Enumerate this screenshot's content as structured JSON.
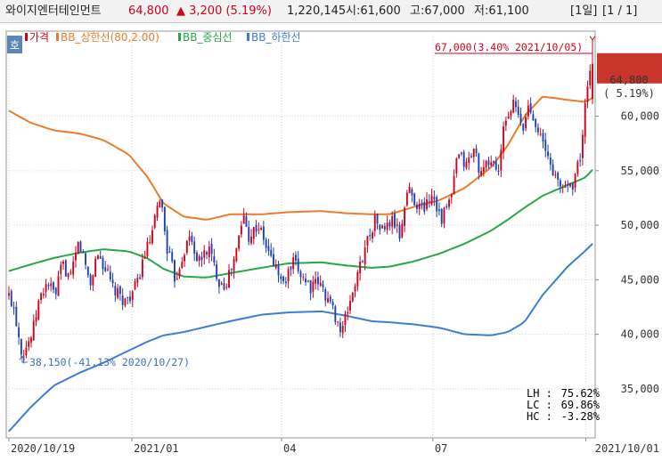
{
  "header": {
    "name": "와이지엔터테인먼트",
    "price": "64,800",
    "change": "▲ 3,200 (5.19%)",
    "volume": "1,220,145",
    "open": "시:61,600",
    "high": "고:67,000",
    "low": "저:61,100",
    "period": "[1일]",
    "page": "[1 / 1]"
  },
  "side_tab_label": "호",
  "colors": {
    "up": "#d0021b",
    "down": "#1f3fb4",
    "bb_upper": "#f07a2a",
    "bb_mid": "#28a745",
    "bb_lower": "#3c7ed4"
  },
  "chart_data": {
    "type": "line",
    "title": "",
    "legend": [
      {
        "key": "price",
        "label": "가격",
        "color": "#d0021b"
      },
      {
        "key": "upper",
        "label": "BB_상한선(80,2.00)",
        "color": "#f07a2a"
      },
      {
        "key": "mid",
        "label": "BB_중심선",
        "color": "#28a745"
      },
      {
        "key": "lower",
        "label": "BB_하한선",
        "color": "#3c7ed4"
      }
    ],
    "legend_position": "top-left",
    "x_ticks": [
      "2020/10/19",
      "2021/01",
      "04",
      "07",
      "2021/10/01"
    ],
    "x_tick_dates": [
      "2020-10-19",
      "2021-01-01",
      "2021-04-01",
      "2021-07-01",
      "2021-10-01"
    ],
    "y_ticks": [
      "35,000",
      "40,000",
      "45,000",
      "50,000",
      "55,000",
      "60,000"
    ],
    "ylim": [
      30500,
      67800
    ],
    "grid": true,
    "price_points": [
      [
        "2020-10-19",
        43500
      ],
      [
        "2020-10-22",
        42500
      ],
      [
        "2020-10-27",
        38150
      ],
      [
        "2020-11-02",
        40000
      ],
      [
        "2020-11-06",
        43000
      ],
      [
        "2020-11-11",
        44800
      ],
      [
        "2020-11-16",
        43500
      ],
      [
        "2020-11-20",
        46500
      ],
      [
        "2020-11-25",
        45000
      ],
      [
        "2020-11-30",
        48500
      ],
      [
        "2020-12-03",
        47000
      ],
      [
        "2020-12-07",
        44500
      ],
      [
        "2020-12-11",
        47500
      ],
      [
        "2020-12-16",
        46000
      ],
      [
        "2020-12-21",
        44000
      ],
      [
        "2020-12-28",
        43000
      ],
      [
        "2021-01-04",
        44500
      ],
      [
        "2021-01-08",
        47000
      ],
      [
        "2021-01-13",
        49000
      ],
      [
        "2021-01-18",
        52800
      ],
      [
        "2021-01-22",
        48000
      ],
      [
        "2021-01-27",
        45000
      ],
      [
        "2021-02-01",
        47500
      ],
      [
        "2021-02-05",
        49000
      ],
      [
        "2021-02-10",
        46500
      ],
      [
        "2021-02-16",
        48000
      ],
      [
        "2021-02-22",
        45000
      ],
      [
        "2021-02-26",
        44500
      ],
      [
        "2021-03-04",
        47000
      ],
      [
        "2021-03-09",
        51000
      ],
      [
        "2021-03-12",
        49000
      ],
      [
        "2021-03-18",
        50000
      ],
      [
        "2021-03-24",
        47500
      ],
      [
        "2021-03-29",
        46000
      ],
      [
        "2021-04-02",
        44500
      ],
      [
        "2021-04-08",
        46500
      ],
      [
        "2021-04-13",
        45500
      ],
      [
        "2021-04-19",
        44200
      ],
      [
        "2021-04-23",
        44800
      ],
      [
        "2021-04-29",
        43200
      ],
      [
        "2021-05-04",
        41500
      ],
      [
        "2021-05-07",
        40000
      ],
      [
        "2021-05-12",
        43000
      ],
      [
        "2021-05-17",
        45500
      ],
      [
        "2021-05-21",
        48000
      ],
      [
        "2021-05-27",
        50500
      ],
      [
        "2021-06-01",
        49500
      ],
      [
        "2021-06-07",
        50500
      ],
      [
        "2021-06-11",
        49000
      ],
      [
        "2021-06-16",
        53500
      ],
      [
        "2021-06-21",
        52000
      ],
      [
        "2021-06-25",
        51500
      ],
      [
        "2021-07-01",
        53000
      ],
      [
        "2021-07-06",
        50500
      ],
      [
        "2021-07-12",
        52500
      ],
      [
        "2021-07-16",
        56500
      ],
      [
        "2021-07-21",
        55500
      ],
      [
        "2021-07-26",
        57000
      ],
      [
        "2021-07-30",
        54500
      ],
      [
        "2021-08-04",
        56000
      ],
      [
        "2021-08-10",
        55000
      ],
      [
        "2021-08-13",
        59500
      ],
      [
        "2021-08-19",
        61200
      ],
      [
        "2021-08-24",
        58500
      ],
      [
        "2021-08-27",
        61000
      ],
      [
        "2021-09-01",
        59500
      ],
      [
        "2021-09-06",
        57000
      ],
      [
        "2021-09-10",
        55500
      ],
      [
        "2021-09-15",
        53500
      ],
      [
        "2021-09-23",
        53800
      ],
      [
        "2021-09-28",
        56500
      ],
      [
        "2021-10-01",
        61600
      ],
      [
        "2021-10-05",
        64800
      ]
    ],
    "series": [
      {
        "key": "upper",
        "name": "BB_상한선(80,2.00)",
        "points": [
          [
            "2020-10-19",
            60500
          ],
          [
            "2020-11-01",
            59400
          ],
          [
            "2020-11-15",
            58700
          ],
          [
            "2020-12-01",
            58400
          ],
          [
            "2020-12-15",
            57800
          ],
          [
            "2020-12-30",
            56500
          ],
          [
            "2021-01-10",
            54500
          ],
          [
            "2021-01-20",
            52000
          ],
          [
            "2021-02-01",
            50800
          ],
          [
            "2021-02-15",
            50500
          ],
          [
            "2021-03-01",
            51000
          ],
          [
            "2021-03-20",
            51000
          ],
          [
            "2021-04-05",
            51200
          ],
          [
            "2021-04-25",
            51300
          ],
          [
            "2021-05-10",
            51100
          ],
          [
            "2021-05-25",
            51000
          ],
          [
            "2021-06-05",
            51000
          ],
          [
            "2021-06-20",
            51700
          ],
          [
            "2021-07-05",
            52300
          ],
          [
            "2021-07-20",
            53400
          ],
          [
            "2021-08-05",
            55300
          ],
          [
            "2021-08-15",
            57300
          ],
          [
            "2021-08-25",
            60000
          ],
          [
            "2021-09-05",
            61800
          ],
          [
            "2021-09-20",
            61500
          ],
          [
            "2021-10-01",
            61300
          ],
          [
            "2021-10-05",
            61700
          ]
        ]
      },
      {
        "key": "mid",
        "name": "BB_중심선",
        "points": [
          [
            "2020-10-19",
            45800
          ],
          [
            "2020-11-01",
            46400
          ],
          [
            "2020-11-15",
            47000
          ],
          [
            "2020-12-01",
            47500
          ],
          [
            "2020-12-15",
            47800
          ],
          [
            "2020-12-30",
            47600
          ],
          [
            "2021-01-10",
            47000
          ],
          [
            "2021-01-20",
            46000
          ],
          [
            "2021-02-01",
            45300
          ],
          [
            "2021-02-15",
            45200
          ],
          [
            "2021-03-01",
            45600
          ],
          [
            "2021-03-20",
            46100
          ],
          [
            "2021-04-05",
            46500
          ],
          [
            "2021-04-25",
            46600
          ],
          [
            "2021-05-10",
            46300
          ],
          [
            "2021-05-25",
            46100
          ],
          [
            "2021-06-05",
            46200
          ],
          [
            "2021-06-20",
            46700
          ],
          [
            "2021-07-05",
            47400
          ],
          [
            "2021-07-20",
            48300
          ],
          [
            "2021-08-05",
            49500
          ],
          [
            "2021-08-15",
            50500
          ],
          [
            "2021-08-25",
            51600
          ],
          [
            "2021-09-05",
            52700
          ],
          [
            "2021-09-20",
            53700
          ],
          [
            "2021-10-01",
            54400
          ],
          [
            "2021-10-05",
            55100
          ]
        ]
      },
      {
        "key": "lower",
        "name": "BB_하한선",
        "points": [
          [
            "2020-10-19",
            31100
          ],
          [
            "2020-11-01",
            33300
          ],
          [
            "2020-11-15",
            35300
          ],
          [
            "2020-12-01",
            36500
          ],
          [
            "2020-12-15",
            37400
          ],
          [
            "2020-12-30",
            38500
          ],
          [
            "2021-01-10",
            39300
          ],
          [
            "2021-01-20",
            39900
          ],
          [
            "2021-02-01",
            40200
          ],
          [
            "2021-02-15",
            40700
          ],
          [
            "2021-03-01",
            41200
          ],
          [
            "2021-03-20",
            41800
          ],
          [
            "2021-04-05",
            42000
          ],
          [
            "2021-04-25",
            42100
          ],
          [
            "2021-05-10",
            41700
          ],
          [
            "2021-05-25",
            41200
          ],
          [
            "2021-06-05",
            41100
          ],
          [
            "2021-06-20",
            40900
          ],
          [
            "2021-07-05",
            40600
          ],
          [
            "2021-07-20",
            40000
          ],
          [
            "2021-08-05",
            39900
          ],
          [
            "2021-08-15",
            40200
          ],
          [
            "2021-08-25",
            41100
          ],
          [
            "2021-09-05",
            43600
          ],
          [
            "2021-09-20",
            46200
          ],
          [
            "2021-10-01",
            47700
          ],
          [
            "2021-10-05",
            48300
          ]
        ]
      }
    ],
    "annotations": {
      "high": {
        "text": "67,000(3.40% 2021/10/05)",
        "date": "2021-10-05",
        "value": 67000
      },
      "low": {
        "text": "38,150(-41.13% 2020/10/27)",
        "date": "2020-10-27",
        "value": 38150
      }
    },
    "last_price": {
      "line1": "64,800",
      "line2": "( 5.19%)",
      "value": 64800
    },
    "stats": [
      {
        "label": "LH :",
        "value": "75.62%",
        "color": "#3a9a3a"
      },
      {
        "label": "LC :",
        "value": "69.86%",
        "color": "#d0021b"
      },
      {
        "label": "HC :",
        "value": "-3.28%",
        "color": "#3c6fc4"
      }
    ]
  }
}
